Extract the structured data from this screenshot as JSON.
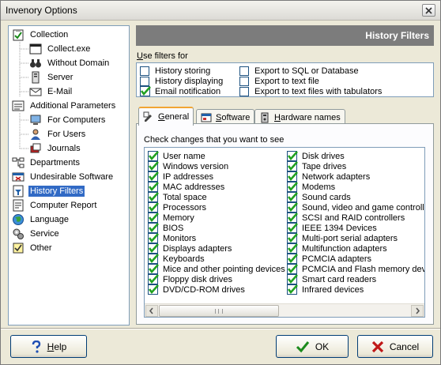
{
  "window": {
    "title": "Invenory Options"
  },
  "tree": {
    "items": [
      {
        "label": "Collection",
        "icon": "clipboard-check-icon"
      },
      {
        "label": "Collect.exe",
        "icon": "window-icon"
      },
      {
        "label": "Without Domain",
        "icon": "binoculars-icon"
      },
      {
        "label": "Server",
        "icon": "server-icon"
      },
      {
        "label": "E-Mail",
        "icon": "email-icon"
      },
      {
        "label": "Additional Parameters",
        "icon": "parameters-icon"
      },
      {
        "label": "For Computers",
        "icon": "computer-icon"
      },
      {
        "label": "For Users",
        "icon": "user-icon"
      },
      {
        "label": "Journals",
        "icon": "journals-icon"
      },
      {
        "label": "Departments",
        "icon": "departments-icon"
      },
      {
        "label": "Undesirable Software",
        "icon": "undesirable-software-icon"
      },
      {
        "label": "History Filters",
        "icon": "history-filters-icon"
      },
      {
        "label": "Computer Report",
        "icon": "report-icon"
      },
      {
        "label": "Language",
        "icon": "globe-icon"
      },
      {
        "label": "Service",
        "icon": "service-icon"
      },
      {
        "label": "Other",
        "icon": "other-icon"
      }
    ],
    "selected": "History Filters"
  },
  "header": {
    "title": "History Filters"
  },
  "filters": {
    "label_u": "U",
    "label_rest": "se filters for",
    "items": [
      {
        "label": "History storing",
        "checked": false
      },
      {
        "label": "History displaying",
        "checked": false
      },
      {
        "label": "Email notification",
        "checked": true
      },
      {
        "label": "Export to SQL or Database",
        "checked": false
      },
      {
        "label": "Export to text file",
        "checked": false
      },
      {
        "label": "Export to text files with tabulators",
        "checked": false
      }
    ]
  },
  "tabs": [
    {
      "u": "G",
      "rest": "eneral",
      "icon": "general-tab-icon"
    },
    {
      "u": "S",
      "rest": "oftware",
      "icon": "software-tab-icon"
    },
    {
      "u": "H",
      "rest": "ardware names",
      "icon": "hardware-tab-icon"
    }
  ],
  "changes": {
    "label": "Check changes that you want to see",
    "left": [
      "User name",
      "Windows version",
      "IP addresses",
      "MAC addresses",
      "Total space",
      "Processors",
      "Memory",
      "BIOS",
      "Monitors",
      "Displays adapters",
      "Keyboards",
      "Mice and other pointing devices",
      "Floppy disk drives",
      "DVD/CD-ROM drives"
    ],
    "right": [
      "Disk drives",
      "Tape drives",
      "Network adapters",
      "Modems",
      "Sound cards",
      "Sound, video and game controlle",
      "SCSI and RAID controllers",
      "IEEE 1394 Devices",
      "Multi-port serial adapters",
      "Multifunction adapters",
      "PCMCIA adapters",
      "PCMCIA and Flash memory devic",
      "Smart card readers",
      "Infrared devices"
    ]
  },
  "buttons": {
    "help_u": "H",
    "help_rest": "elp",
    "ok": "OK",
    "cancel": "Cancel"
  }
}
